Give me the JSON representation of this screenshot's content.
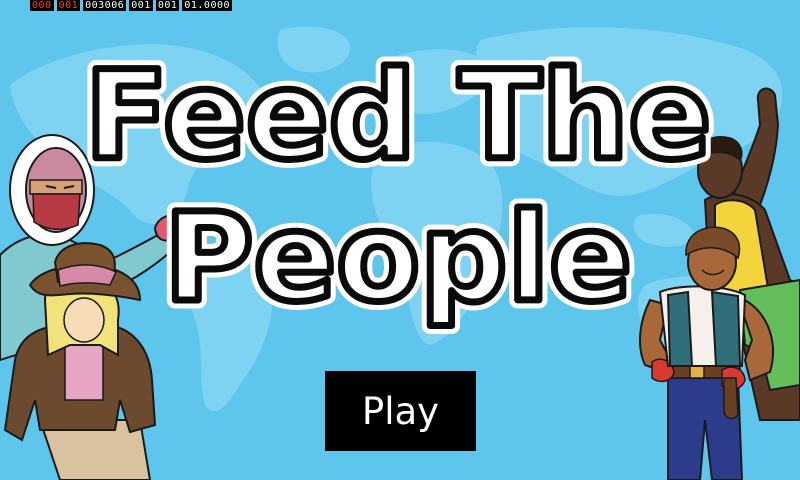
{
  "debug": {
    "counters": [
      "000",
      "001",
      "003006",
      "001",
      "001",
      "01.0000"
    ],
    "counter_colors": [
      "#ff3b2a",
      "#ff3b2a",
      "#ffffff",
      "#ffffff",
      "#ffffff",
      "#ffffff"
    ]
  },
  "title": {
    "line1": "Feed The",
    "line2": "People"
  },
  "play_button": {
    "label": "Play"
  },
  "colors": {
    "background": "#5ec6ec",
    "map": "#7fd3f2",
    "button": "#000000",
    "button_text": "#ffffff",
    "title_fill": "#ffffff",
    "title_stroke": "#0a0a0a"
  },
  "icons": [
    "world-map",
    "parka-character",
    "cowgirl-character",
    "waving-man-character",
    "vest-man-character"
  ]
}
